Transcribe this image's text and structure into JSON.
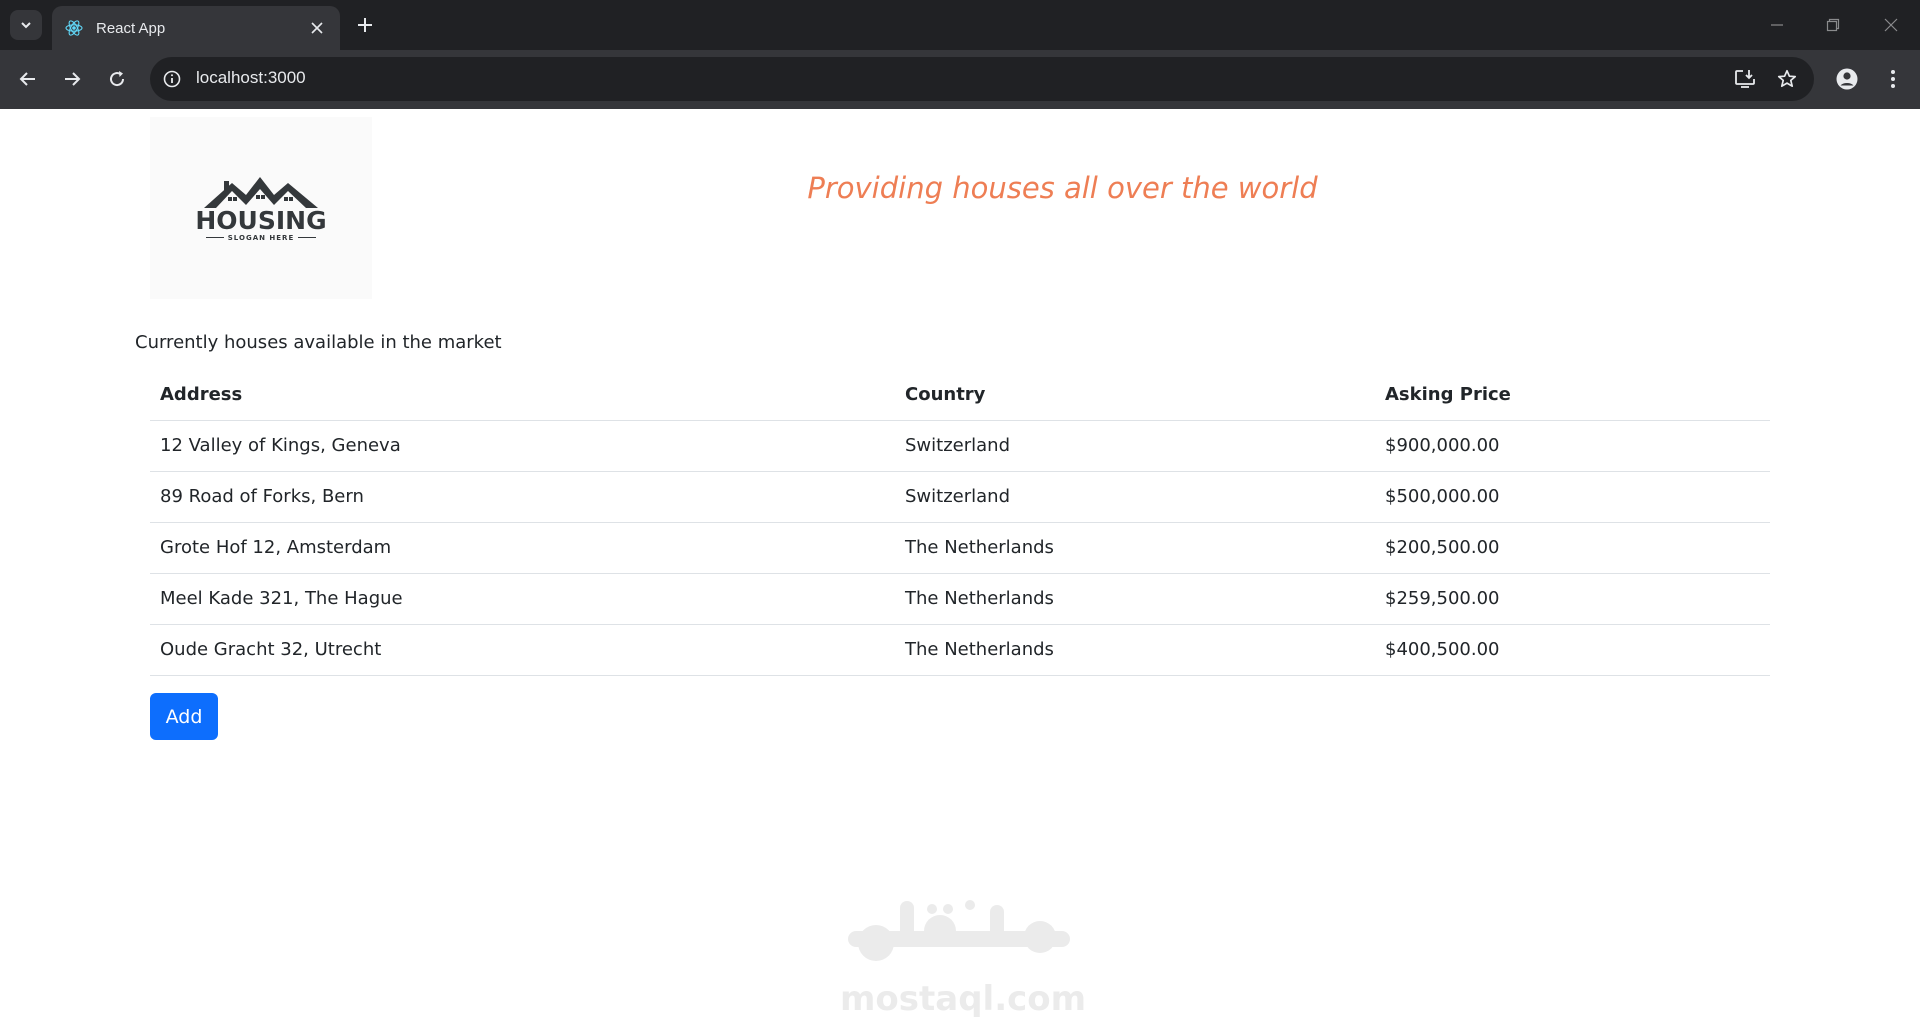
{
  "browser": {
    "tab_title": "React App",
    "url": "localhost:3000",
    "icons": {
      "tab_search": "chevron-down-icon",
      "favicon": "react-icon",
      "tab_close": "close-icon",
      "new_tab": "plus-icon",
      "back": "arrow-left-icon",
      "forward": "arrow-right-icon",
      "reload": "reload-icon",
      "site_info": "info-icon",
      "install": "install-app-icon",
      "bookmark": "star-icon",
      "profile": "profile-icon",
      "menu": "kebab-menu-icon",
      "minimize": "minimize-icon",
      "restore": "restore-icon",
      "close_window": "close-icon"
    }
  },
  "header": {
    "logo_word": "HOUSING",
    "logo_slogan": "SLOGAN HERE",
    "tagline": "Providing houses all over the world",
    "tagline_color": "#ee7e54"
  },
  "main": {
    "subtitle": "Currently houses available in the market",
    "table": {
      "headers": [
        "Address",
        "Country",
        "Asking Price"
      ],
      "rows": [
        [
          "12 Valley of Kings, Geneva",
          "Switzerland",
          "$900,000.00"
        ],
        [
          "89 Road of Forks, Bern",
          "Switzerland",
          "$500,000.00"
        ],
        [
          "Grote Hof 12, Amsterdam",
          "The Netherlands",
          "$200,500.00"
        ],
        [
          "Meel Kade 321, The Hague",
          "The Netherlands",
          "$259,500.00"
        ],
        [
          "Oude Gracht 32, Utrecht",
          "The Netherlands",
          "$400,500.00"
        ]
      ]
    },
    "add_label": "Add",
    "add_color": "#0d6efd"
  },
  "watermark": {
    "arabic": "مستقل",
    "latin": "mostaql.com"
  }
}
